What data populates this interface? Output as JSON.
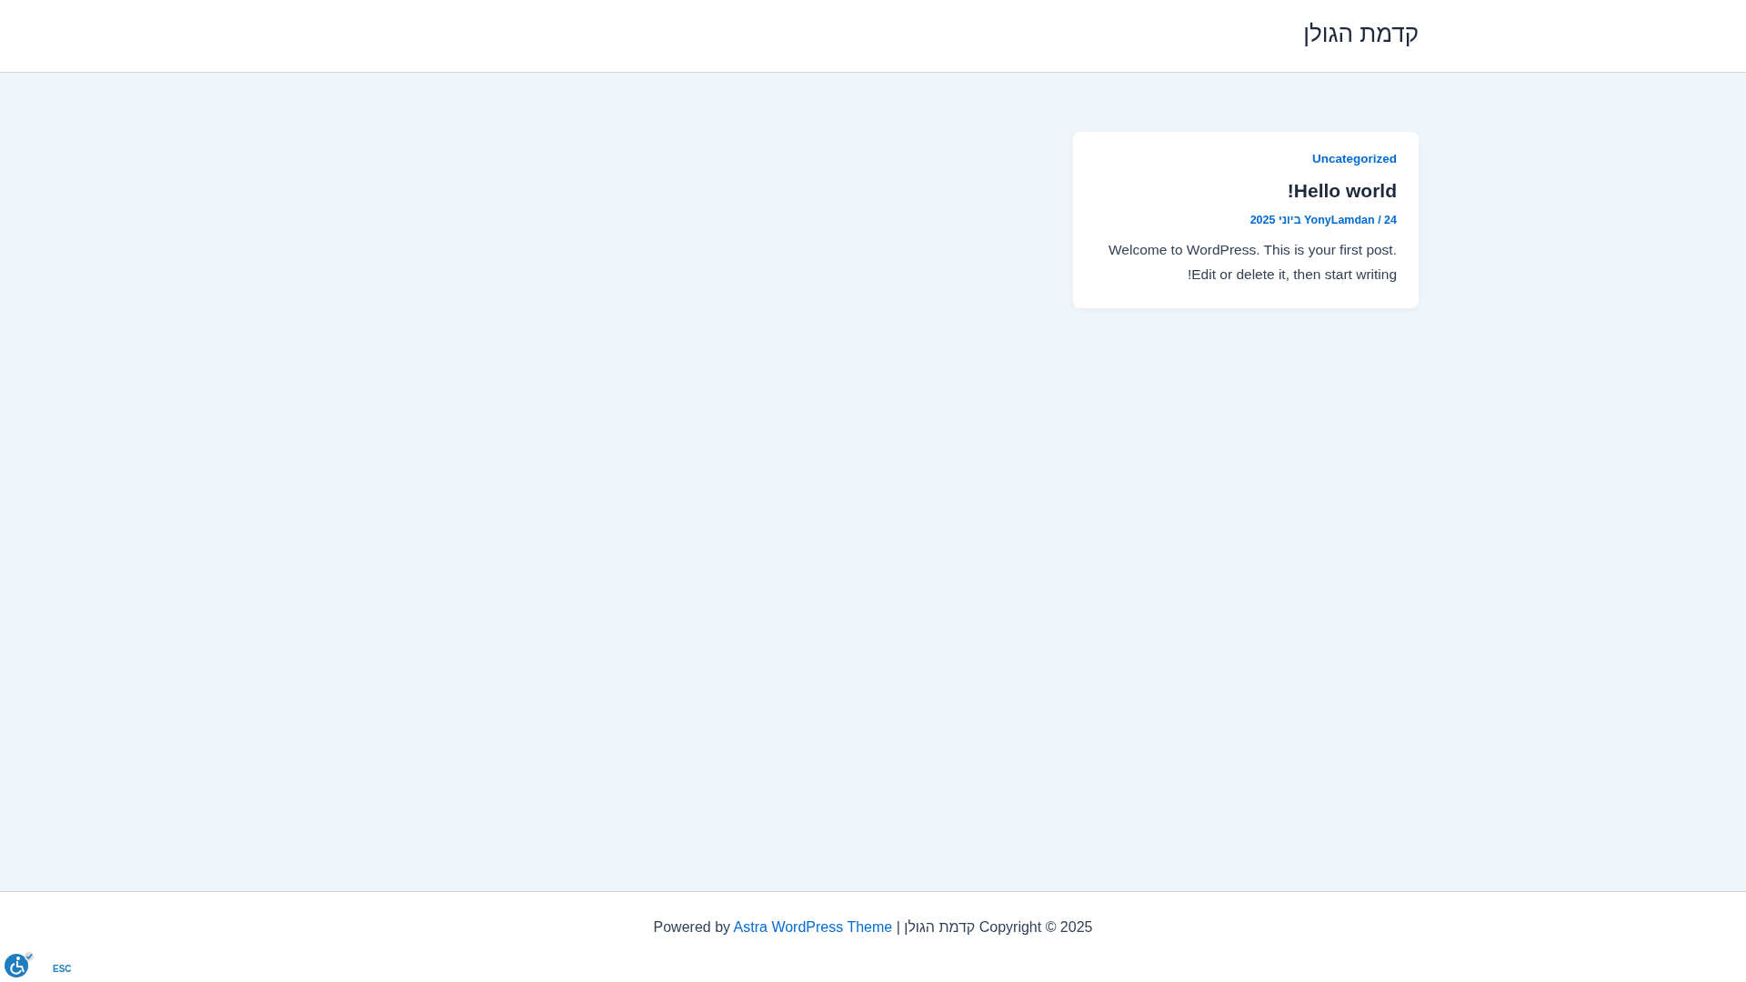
{
  "header": {
    "site_title": "קדמת הגולן"
  },
  "posts": [
    {
      "category": "Uncategorized",
      "title": "Hello world!",
      "meta": "YonyLamdan / 24 ביוני 2025",
      "excerpt": "Welcome to WordPress. This is your first post. Edit or delete it, then start writing!"
    }
  ],
  "footer": {
    "text": "Copyright © 2025 קדמת הגולן | Powered by ",
    "link": "Astra WordPress Theme"
  },
  "accessibility": {
    "label": "ESC"
  }
}
